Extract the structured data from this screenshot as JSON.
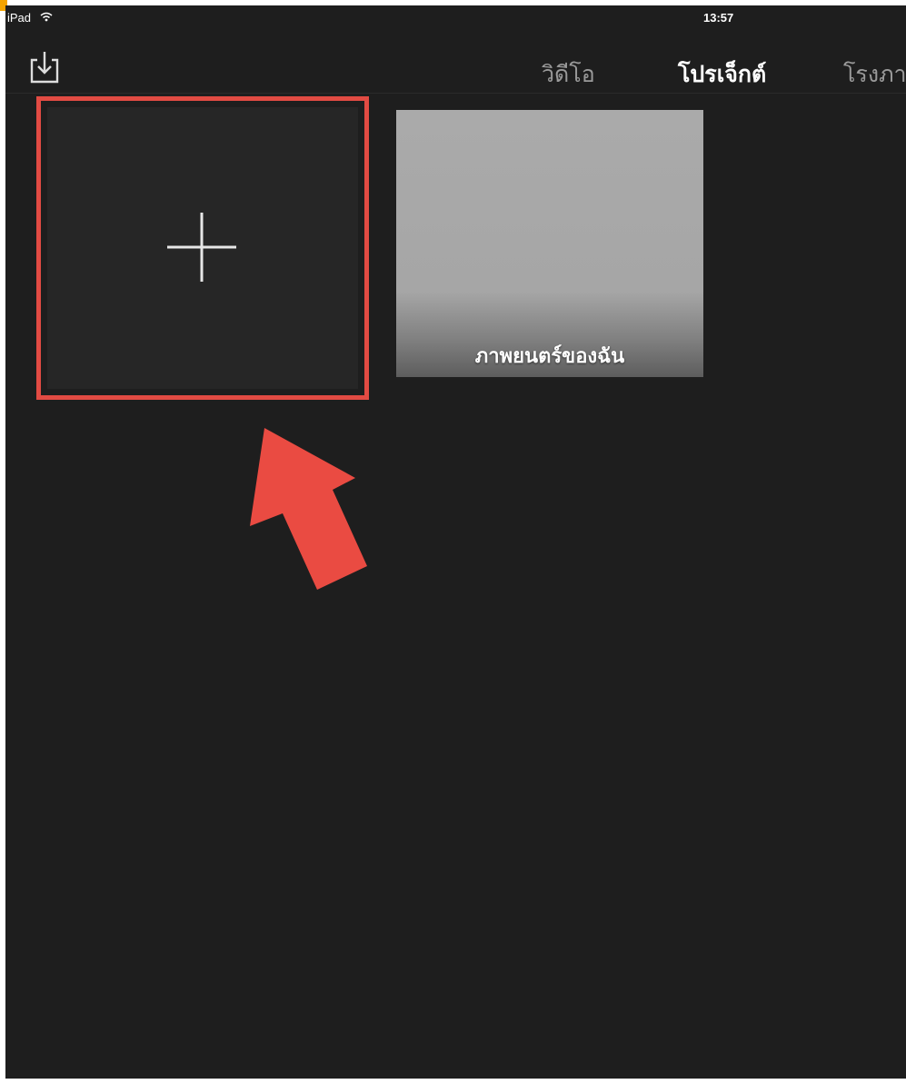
{
  "status_bar": {
    "device": "iPad",
    "time": "13:57",
    "wifi_icon": "wifi-icon"
  },
  "nav": {
    "import_icon": "import-icon",
    "tabs": [
      {
        "label": "วิดีโอ",
        "active": false
      },
      {
        "label": "โปรเจ็กต์",
        "active": true
      },
      {
        "label": "โรงภา",
        "active": false
      }
    ]
  },
  "projects": {
    "new_project_icon": "plus-icon",
    "items": [
      {
        "title": "ภาพยนตร์ของฉัน"
      }
    ]
  },
  "annotation": {
    "highlight_color": "#e24b43",
    "arrow_icon": "red-arrow-icon"
  },
  "colors": {
    "background": "#1e1e1e",
    "active_tab": "#ffffff",
    "inactive_tab": "#9a9a9a",
    "accent_corner": "#f4a300"
  }
}
